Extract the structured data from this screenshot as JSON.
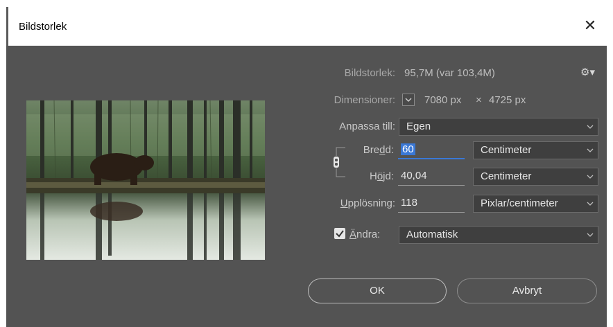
{
  "window": {
    "title": "Bildstorlek"
  },
  "info": {
    "size_label": "Bildstorlek:",
    "size_value": "95,7M (var 103,4M)",
    "dimensions_label": "Dimensioner:",
    "width_px": "7080 px",
    "times": "×",
    "height_px": "4725 px"
  },
  "fit": {
    "label": "Anpassa till:",
    "value": "Egen"
  },
  "width": {
    "label_pre": "Bre",
    "label_mn": "d",
    "label_post": "d:",
    "value": "60",
    "unit": "Centimeter"
  },
  "height": {
    "label_pre": "H",
    "label_mn": "ö",
    "label_post": "jd:",
    "value": "40,04",
    "unit": "Centimeter"
  },
  "resolution": {
    "label_mn": "U",
    "label_post": "pplösning:",
    "value": "118",
    "unit": "Pixlar/centimeter"
  },
  "resample": {
    "label_pre": "",
    "label_mn": "Ä",
    "label_post": "ndra:",
    "value": "Automatisk",
    "checked": true
  },
  "buttons": {
    "ok": "OK",
    "cancel": "Avbryt"
  },
  "icons": {
    "close": "close-icon",
    "gear": "gear-icon",
    "chain": "chain-link-icon",
    "chevron": "chevron-down-icon"
  },
  "colors": {
    "dialog_bg": "#535353",
    "accent": "#3a78d6"
  }
}
